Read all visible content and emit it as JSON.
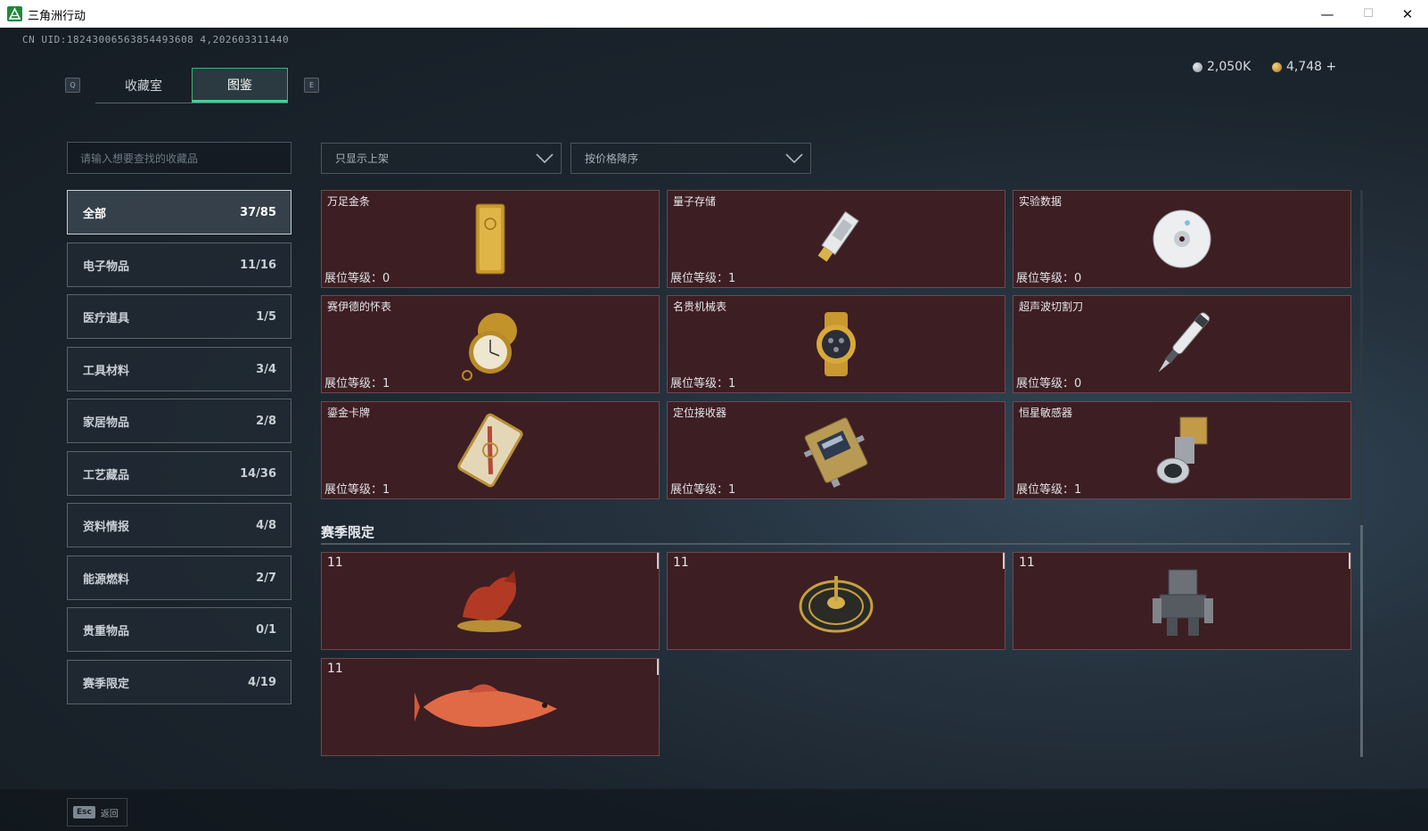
{
  "window": {
    "title": "三角洲行动",
    "minimize": "—",
    "maximize": "☐",
    "close": "✕"
  },
  "uid": "CN UID:18243006563854493608 4,202603311440",
  "currency": [
    {
      "value": "2,050K",
      "coin_color": "#b9bec3"
    },
    {
      "value": "4,748 +",
      "coin_color": "#d9a441"
    }
  ],
  "hotkeys": {
    "prev": "Q",
    "next": "E"
  },
  "tabs": [
    {
      "label": "收藏室",
      "active": false
    },
    {
      "label": "图鉴",
      "active": true
    }
  ],
  "search": {
    "placeholder": "请输入想要查找的收藏品"
  },
  "categories": [
    {
      "label": "全部",
      "count": "37/85",
      "active": true
    },
    {
      "label": "电子物品",
      "count": "11/16"
    },
    {
      "label": "医疗道具",
      "count": "1/5"
    },
    {
      "label": "工具材料",
      "count": "3/4"
    },
    {
      "label": "家居物品",
      "count": "2/8"
    },
    {
      "label": "工艺藏品",
      "count": "14/36"
    },
    {
      "label": "资料情报",
      "count": "4/8"
    },
    {
      "label": "能源燃料",
      "count": "2/7"
    },
    {
      "label": "贵重物品",
      "count": "0/1"
    },
    {
      "label": "赛季限定",
      "count": "4/19"
    }
  ],
  "filters": {
    "shelf": "只显示上架",
    "sort": "按价格降序"
  },
  "items": [
    {
      "name": "万足金条",
      "level": "展位等级：0",
      "icon": "gold-bar-icon"
    },
    {
      "name": "量子存储",
      "level": "展位等级：1",
      "icon": "usb-drive-icon"
    },
    {
      "name": "实验数据",
      "level": "展位等级：0",
      "icon": "disc-icon"
    },
    {
      "name": "赛伊德的怀表",
      "level": "展位等级：1",
      "icon": "pocket-watch-icon"
    },
    {
      "name": "名贵机械表",
      "level": "展位等级：1",
      "icon": "wristwatch-icon"
    },
    {
      "name": "超声波切割刀",
      "level": "展位等级：0",
      "icon": "cutter-icon"
    },
    {
      "name": "鎏金卡牌",
      "level": "展位等级：1",
      "icon": "gilded-card-icon"
    },
    {
      "name": "定位接收器",
      "level": "展位等级：1",
      "icon": "receiver-icon"
    },
    {
      "name": "恒星敏感器",
      "level": "展位等级：1",
      "icon": "star-sensor-icon"
    }
  ],
  "season": {
    "title": "赛季限定",
    "items": [
      {
        "tier": "11",
        "icon": "horse-statue-icon"
      },
      {
        "tier": "11",
        "icon": "compass-dial-icon"
      },
      {
        "tier": "11",
        "icon": "mech-figure-icon"
      },
      {
        "tier": "11",
        "icon": "red-fish-icon"
      }
    ]
  },
  "footer": {
    "key": "Esc",
    "label": "返回"
  }
}
